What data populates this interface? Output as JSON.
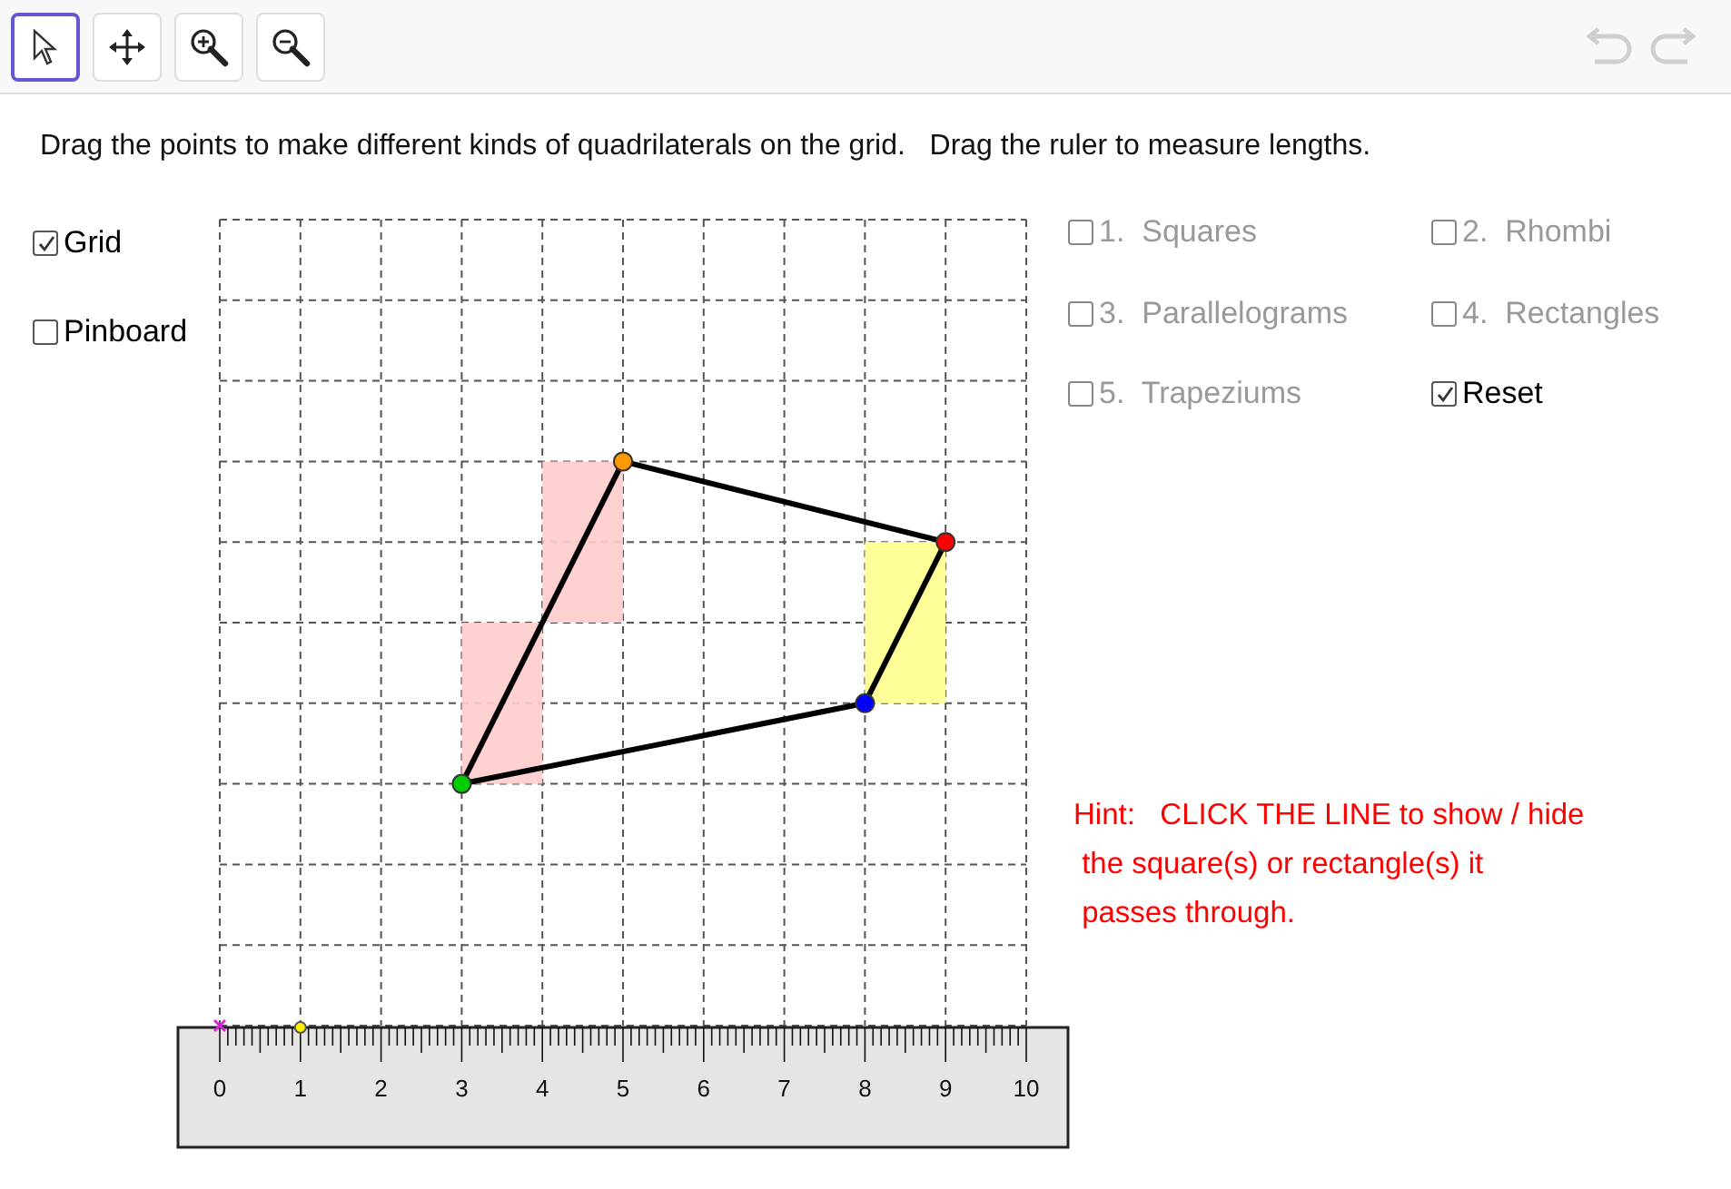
{
  "toolbar": {
    "tools": [
      {
        "kind": "pointer",
        "selected": true
      },
      {
        "kind": "move",
        "selected": false
      },
      {
        "kind": "zoom-in",
        "selected": false
      },
      {
        "kind": "zoom-out",
        "selected": false
      }
    ],
    "undo": {
      "disabled": true
    },
    "redo": {
      "disabled": true
    }
  },
  "instruction": "Drag the points to make different kinds of quadrilaterals on the grid.   Drag the ruler to measure lengths.",
  "view_options": [
    {
      "label": "Grid",
      "checked": true
    },
    {
      "label": "Pinboard",
      "checked": false
    }
  ],
  "shape_options": [
    {
      "label": "1.  Squares",
      "checked": false,
      "disabled": true
    },
    {
      "label": "2.  Rhombi",
      "checked": false,
      "disabled": true
    },
    {
      "label": "3.  Parallelograms",
      "checked": false,
      "disabled": true
    },
    {
      "label": "4.  Rectangles",
      "checked": false,
      "disabled": true
    },
    {
      "label": "5.  Trapeziums",
      "checked": false,
      "disabled": true
    },
    {
      "label": "Reset",
      "checked": true,
      "disabled": false
    }
  ],
  "hint": [
    "Hint:   CLICK THE LINE to show / hide",
    " the square(s) or rectangle(s) it",
    " passes through."
  ],
  "ruler": {
    "labels": [
      "0",
      "1",
      "2",
      "3",
      "4",
      "5",
      "6",
      "7",
      "8",
      "9",
      "10"
    ]
  }
}
